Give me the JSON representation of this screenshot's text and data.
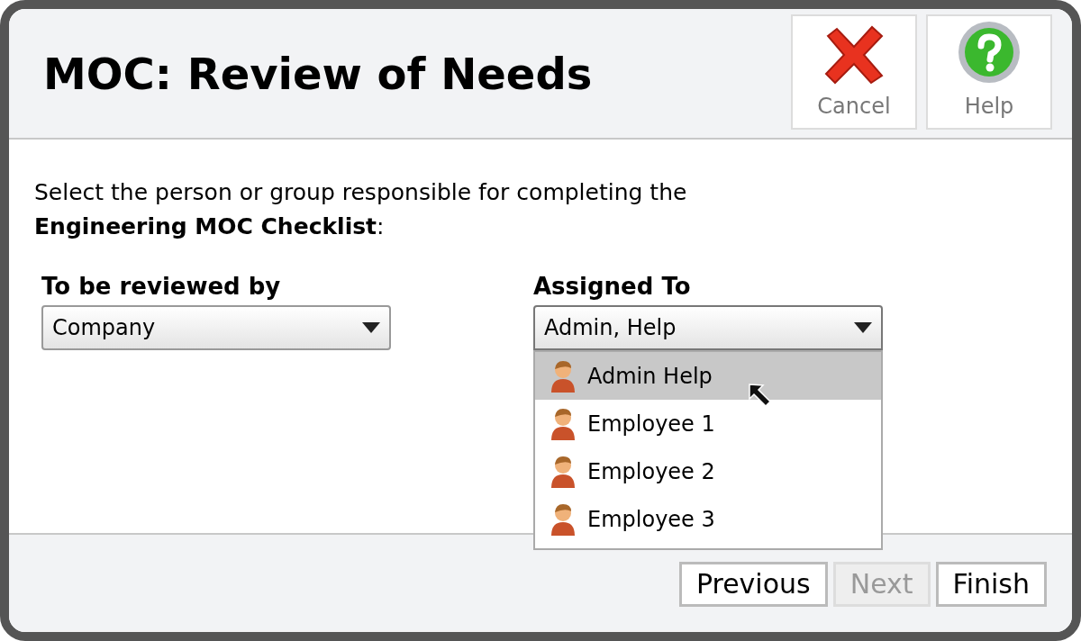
{
  "title": "MOC: Review of Needs",
  "header_buttons": [
    {
      "kind": "cancel",
      "label": "Cancel"
    },
    {
      "kind": "help",
      "label": "Help"
    }
  ],
  "instruction": "Select the person or group responsible for completing the **Engineering MOC Checklist**:",
  "fields": [
    {
      "label": "To be reviewed by",
      "value": "Company",
      "expanded": false
    },
    {
      "label": "Assigned To",
      "value": "Admin, Help",
      "expanded": true,
      "options": [
        {
          "label": "Admin Help",
          "selected": true
        },
        {
          "label": "Employee 1",
          "selected": false
        },
        {
          "label": "Employee 2",
          "selected": false
        },
        {
          "label": "Employee 3",
          "selected": false
        }
      ]
    }
  ],
  "footer_buttons": [
    {
      "label": "Previous",
      "disabled": false
    },
    {
      "label": "Next",
      "disabled": true
    },
    {
      "label": "Finish",
      "disabled": false
    }
  ]
}
